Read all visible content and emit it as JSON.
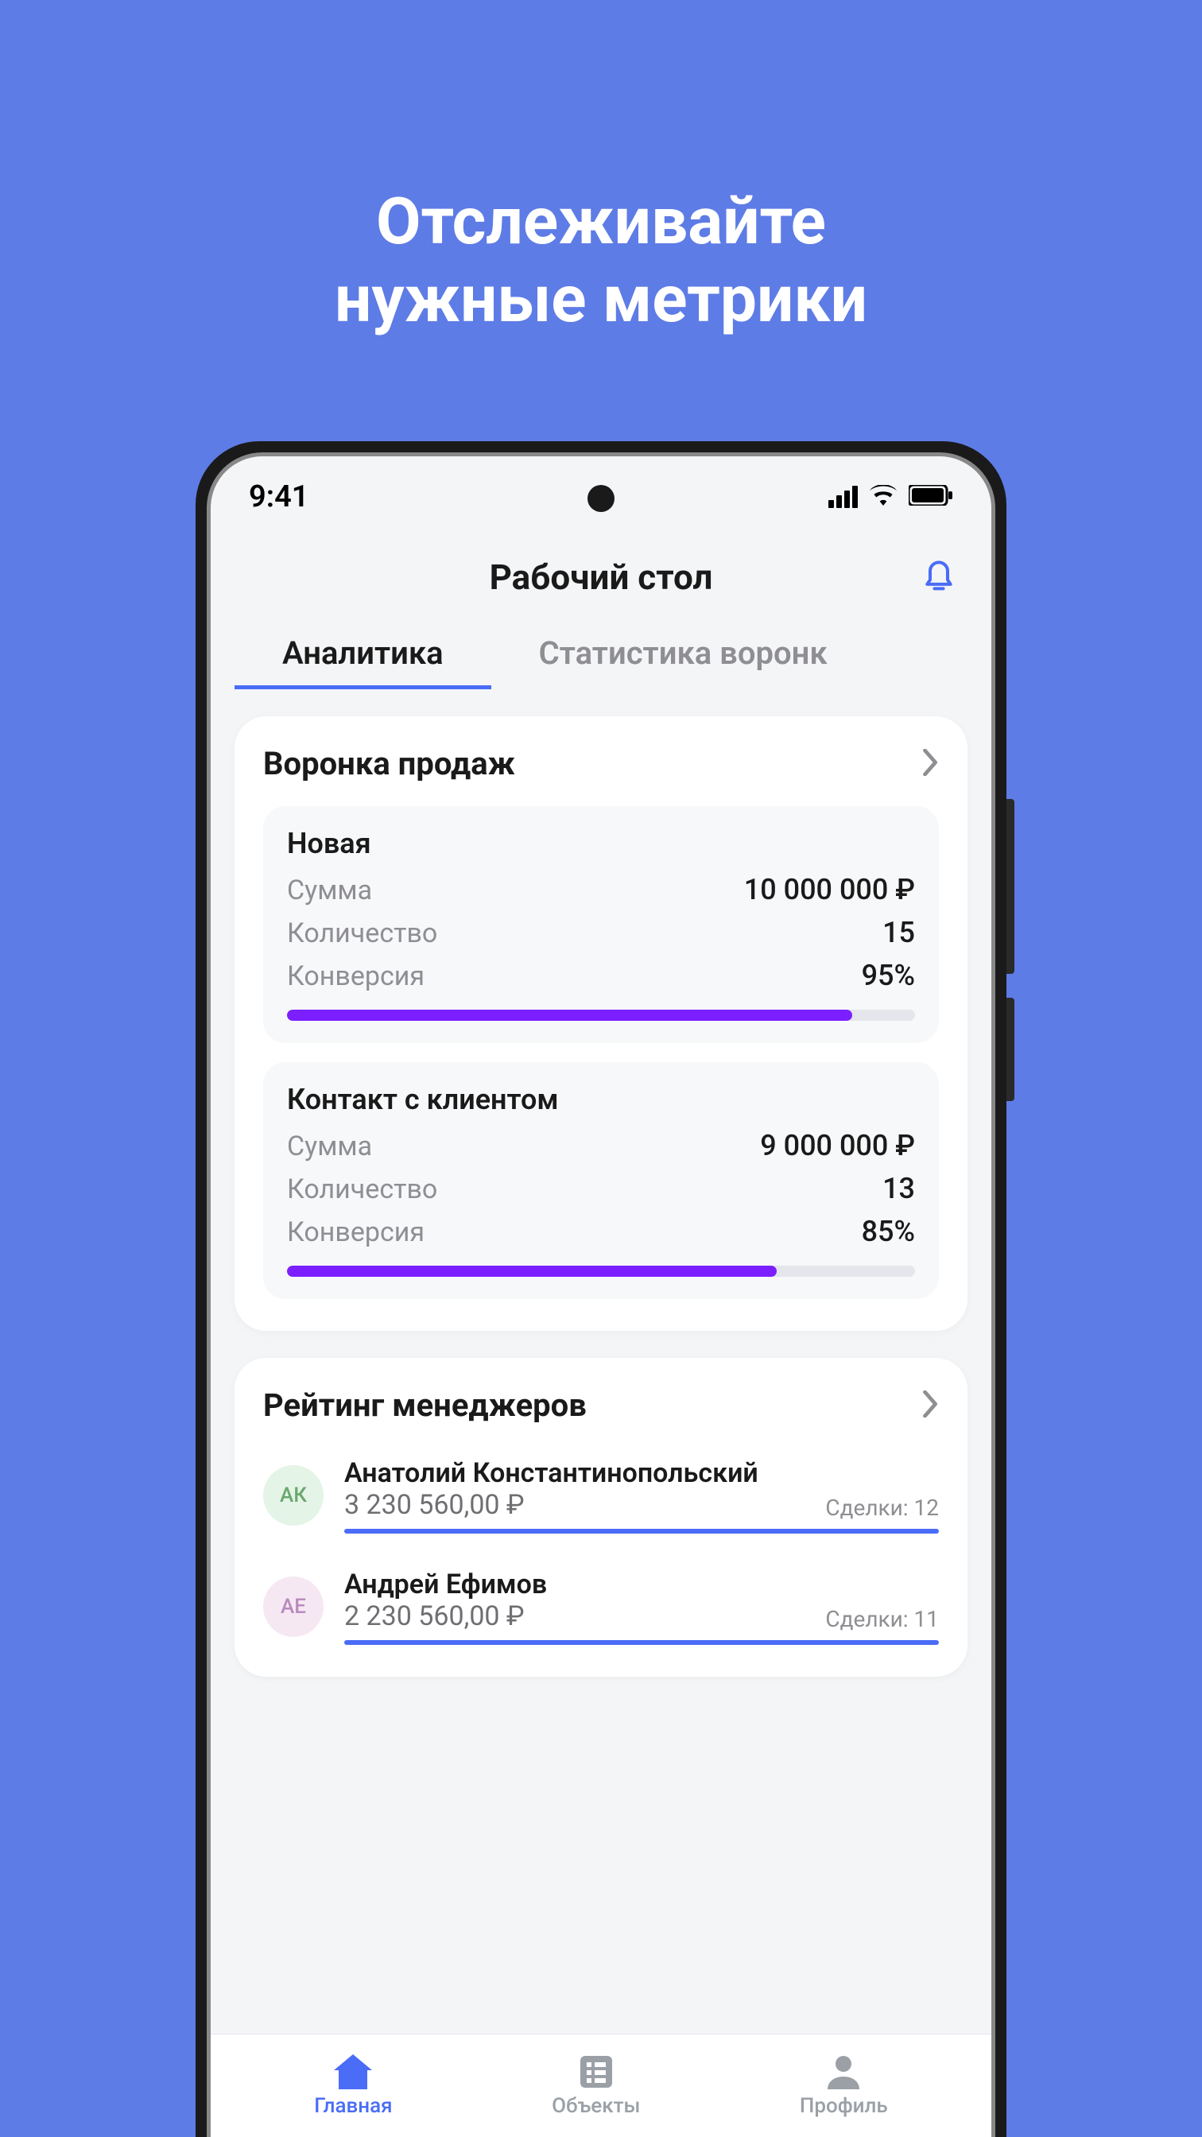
{
  "marketing": {
    "line1": "Отслеживайте",
    "line2": "нужные метрики"
  },
  "status": {
    "time": "9:41"
  },
  "header": {
    "title": "Рабочий стол"
  },
  "tabs": [
    {
      "label": "Аналитика",
      "active": true
    },
    {
      "label": "Статистика воронк",
      "active": false
    }
  ],
  "funnel": {
    "title": "Воронка продаж",
    "stages": [
      {
        "name": "Новая",
        "sum_label": "Сумма",
        "sum_value": "10 000 000 ₽",
        "count_label": "Количество",
        "count_value": "15",
        "conv_label": "Конверсия",
        "conv_value": "95%",
        "conv_pct": 90
      },
      {
        "name": "Контакт с клиентом",
        "sum_label": "Сумма",
        "sum_value": "9 000 000 ₽",
        "count_label": "Количество",
        "count_value": "13",
        "conv_label": "Конверсия",
        "conv_value": "85%",
        "conv_pct": 78
      }
    ]
  },
  "managers": {
    "title": "Рейтинг менеджеров",
    "deals_prefix": "Сделки: ",
    "list": [
      {
        "initials": "АК",
        "avatar_bg": "#e4f4e6",
        "avatar_fg": "#6aa86f",
        "name": "Анатолий Константинопольский",
        "amount": "3 230 560,00 ₽",
        "deals": "12",
        "bar_pct": 100
      },
      {
        "initials": "АЕ",
        "avatar_bg": "#f6e8f2",
        "avatar_fg": "#b88abf",
        "name": "Андрей Ефимов",
        "amount": "2 230 560,00 ₽",
        "deals": "11",
        "bar_pct": 100
      }
    ]
  },
  "tabbar": [
    {
      "label": "Главная",
      "active": true
    },
    {
      "label": "Объекты",
      "active": false
    },
    {
      "label": "Профиль",
      "active": false
    }
  ]
}
